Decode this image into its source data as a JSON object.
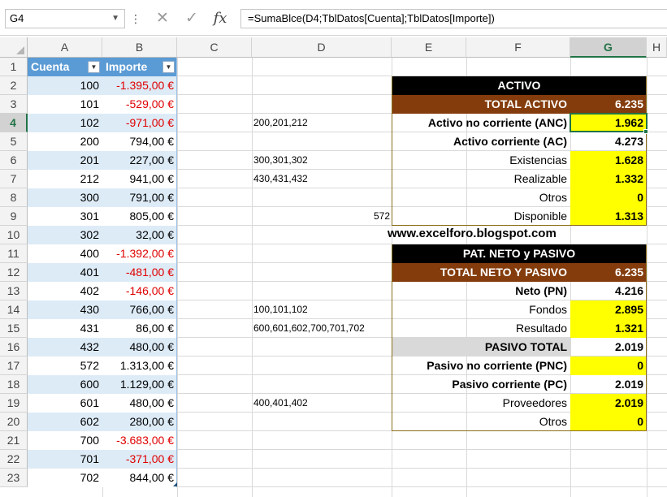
{
  "formula_bar": {
    "name_box": "G4",
    "name_box_arrow": "▼",
    "more_dots": "⋮",
    "cancel_glyph": "✕",
    "enter_glyph": "✓",
    "fx_label": "fx",
    "formula": "=SumaBlce(D4;TblDatos[Cuenta];TblDatos[Importe])"
  },
  "columns": [
    "A",
    "B",
    "C",
    "D",
    "E",
    "F",
    "G",
    "H"
  ],
  "selected_column": "G",
  "rows": [
    "1",
    "2",
    "3",
    "4",
    "5",
    "6",
    "7",
    "8",
    "9",
    "10",
    "11",
    "12",
    "13",
    "14",
    "15",
    "16",
    "17",
    "18",
    "19",
    "20",
    "21",
    "22",
    "23"
  ],
  "selected_row": "4",
  "table": {
    "header_cuenta": "Cuenta",
    "header_importe": "Importe",
    "filter_glyph": "▼",
    "records": [
      {
        "cuenta": "100",
        "importe": "-1.395,00 €",
        "negative": true
      },
      {
        "cuenta": "101",
        "importe": "-529,00 €",
        "negative": true
      },
      {
        "cuenta": "102",
        "importe": "-971,00 €",
        "negative": true
      },
      {
        "cuenta": "200",
        "importe": "794,00 €",
        "negative": false
      },
      {
        "cuenta": "201",
        "importe": "227,00 €",
        "negative": false
      },
      {
        "cuenta": "212",
        "importe": "941,00 €",
        "negative": false
      },
      {
        "cuenta": "300",
        "importe": "791,00 €",
        "negative": false
      },
      {
        "cuenta": "301",
        "importe": "805,00 €",
        "negative": false
      },
      {
        "cuenta": "302",
        "importe": "32,00 €",
        "negative": false
      },
      {
        "cuenta": "400",
        "importe": "-1.392,00 €",
        "negative": true
      },
      {
        "cuenta": "401",
        "importe": "-481,00 €",
        "negative": true
      },
      {
        "cuenta": "402",
        "importe": "-146,00 €",
        "negative": true
      },
      {
        "cuenta": "430",
        "importe": "766,00 €",
        "negative": false
      },
      {
        "cuenta": "431",
        "importe": "86,00 €",
        "negative": false
      },
      {
        "cuenta": "432",
        "importe": "480,00 €",
        "negative": false
      },
      {
        "cuenta": "572",
        "importe": "1.313,00 €",
        "negative": false
      },
      {
        "cuenta": "600",
        "importe": "1.129,00 €",
        "negative": false
      },
      {
        "cuenta": "601",
        "importe": "480,00 €",
        "negative": false
      },
      {
        "cuenta": "602",
        "importe": "280,00 €",
        "negative": false
      },
      {
        "cuenta": "700",
        "importe": "-3.683,00 €",
        "negative": true
      },
      {
        "cuenta": "701",
        "importe": "-371,00 €",
        "negative": true
      },
      {
        "cuenta": "702",
        "importe": "844,00 €",
        "negative": false
      }
    ]
  },
  "column_d": [
    {
      "row": 4,
      "text": "200,201,212"
    },
    {
      "row": 6,
      "text": "300,301,302"
    },
    {
      "row": 7,
      "text": "430,431,432"
    },
    {
      "row": 9,
      "text": "572"
    },
    {
      "row": 14,
      "text": "100,101,102"
    },
    {
      "row": 15,
      "text": "600,601,602,700,701,702"
    },
    {
      "row": 19,
      "text": "400,401,402"
    }
  ],
  "activo": {
    "title": "ACTIVO",
    "rows": [
      {
        "label": "TOTAL ACTIVO",
        "value": "6.235",
        "style": "brown"
      },
      {
        "label": "Activo no corriente (ANC)",
        "value": "1.962",
        "style": "bold-yellow"
      },
      {
        "label": "Activo corriente (AC)",
        "value": "4.273",
        "style": "bold"
      },
      {
        "label": "Existencias",
        "value": "1.628",
        "style": "yellow"
      },
      {
        "label": "Realizable",
        "value": "1.332",
        "style": "yellow"
      },
      {
        "label": "Otros",
        "value": "0",
        "style": "yellow"
      },
      {
        "label": "Disponible",
        "value": "1.313",
        "style": "yellow"
      }
    ]
  },
  "watermark": "www.excelforo.blogspot.com",
  "pasivo": {
    "title": "PAT. NETO y PASIVO",
    "rows": [
      {
        "label": "TOTAL NETO Y PASIVO",
        "value": "6.235",
        "style": "brown"
      },
      {
        "label": "Neto (PN)",
        "value": "4.216",
        "style": "bold"
      },
      {
        "label": "Fondos",
        "value": "2.895",
        "style": "yellow"
      },
      {
        "label": "Resultado",
        "value": "1.321",
        "style": "yellow"
      },
      {
        "label": "PASIVO TOTAL",
        "value": "2.019",
        "style": "grey"
      },
      {
        "label": "Pasivo no corriente (PNC)",
        "value": "0",
        "style": "bold-yellow"
      },
      {
        "label": "Pasivo corriente (PC)",
        "value": "2.019",
        "style": "bold"
      },
      {
        "label": "Proveedores",
        "value": "2.019",
        "style": "yellow"
      },
      {
        "label": "Otros",
        "value": "0",
        "style": "yellow"
      }
    ]
  },
  "colors": {
    "table_header": "#5b9bd5",
    "table_band": "#ddebf7",
    "negative": "#e00000",
    "section_header": "#000000",
    "total_row": "#843c0c",
    "highlight": "#ffff00",
    "selection": "#217346"
  }
}
